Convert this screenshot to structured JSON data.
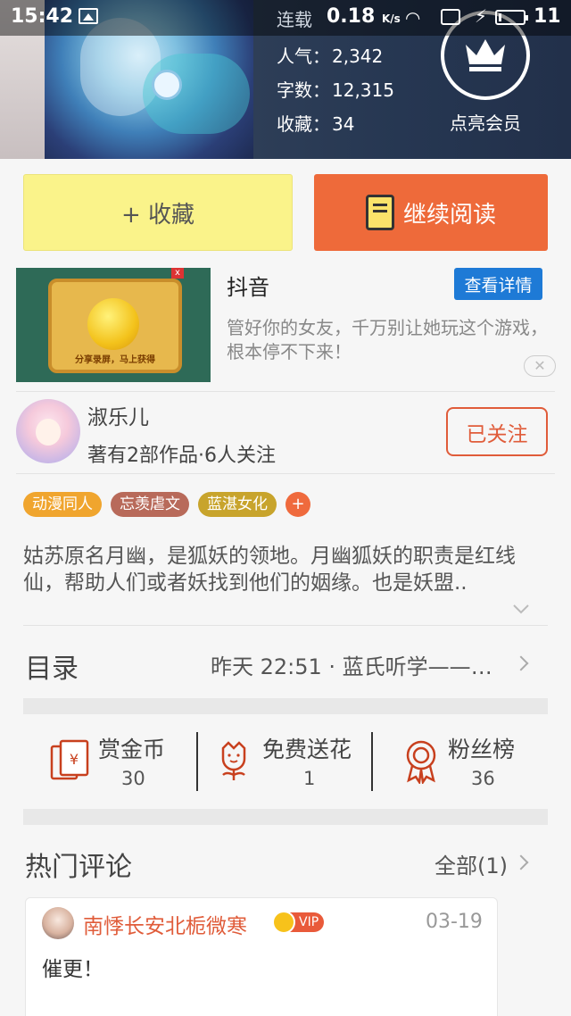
{
  "statusbar": {
    "time": "15:42",
    "serial": "连载",
    "speed": "0.18",
    "speed_unit": "K/s",
    "battery_level": "11",
    "battery_fraction": 0.11
  },
  "book": {
    "stats": [
      {
        "label": "人气：",
        "value": "2,342"
      },
      {
        "label": "字数：",
        "value": "12,315"
      },
      {
        "label": "收藏：",
        "value": "34"
      }
    ],
    "member_label": "点亮会员"
  },
  "actions": {
    "collect": "+ 收藏",
    "continue_read": "继续阅读"
  },
  "ad": {
    "image_text": "分享录屏，马上获得",
    "title": "抖音",
    "detail_button": "查看详情",
    "description": "管好你的女友，千万别让她玩这个游戏，根本停不下来！",
    "close": "✕"
  },
  "author": {
    "name": "淑乐儿",
    "meta": "著有2部作品·6人关注",
    "follow_button": "已关注"
  },
  "tags": [
    {
      "label": "动漫同人",
      "color": "#f0a52e"
    },
    {
      "label": "忘羡虐文",
      "color": "#b86a5a"
    },
    {
      "label": "蓝湛女化",
      "color": "#c8a42c"
    }
  ],
  "tag_add": "+",
  "synopsis": "姑苏原名月幽，是狐妖的领地。月幽狐妖的职责是红线仙，帮助人们或者妖找到他们的姻缘。也是妖盟..",
  "catalog": {
    "label": "目录",
    "latest": "昨天 22:51 · 蓝氏听学——轩.."
  },
  "rewards": [
    {
      "label": "赏金币",
      "value": "30",
      "icon": "red-envelope-icon"
    },
    {
      "label": "免费送花",
      "value": "1",
      "icon": "flower-icon"
    },
    {
      "label": "粉丝榜",
      "value": "36",
      "icon": "medal-icon"
    }
  ],
  "comments": {
    "title": "热门评论",
    "all_link": "全部(1)",
    "items": [
      {
        "user": "南悸长安北栀微寒",
        "badge": "VIP",
        "date": "03-19",
        "text": "催更！"
      }
    ]
  },
  "colors": {
    "accent": "#ee6a3a",
    "collect_bg": "#faf38a",
    "link_blue": "#1e7ad6"
  }
}
